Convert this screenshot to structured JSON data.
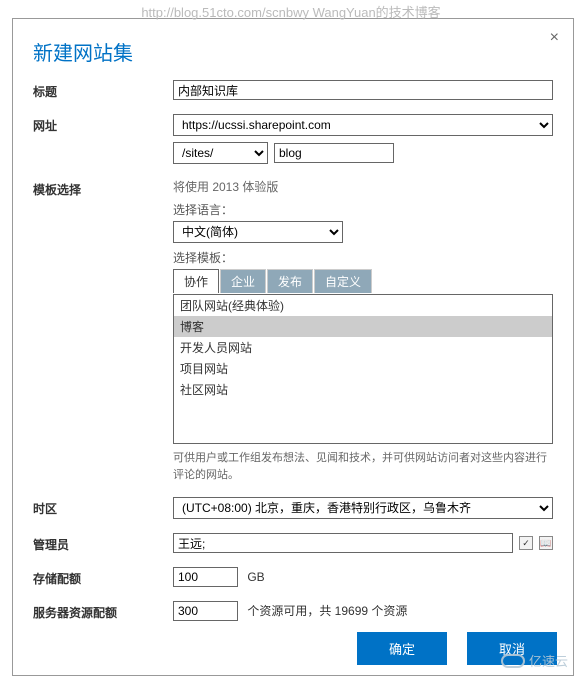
{
  "watermark": "http://blog.51cto.com/scnbwy WangYuan的技术博客",
  "dialog": {
    "title": "新建网站集",
    "close": "×"
  },
  "labels": {
    "title": "标题",
    "url": "网址",
    "template": "模板选择",
    "timezone": "时区",
    "admin": "管理员",
    "storage": "存储配额",
    "server_res": "服务器资源配额"
  },
  "fields": {
    "title_value": "内部知识库",
    "domain_value": "https://ucssi.sharepoint.com",
    "path_value": "/sites/",
    "site_value": "blog",
    "template_hint": "将使用 2013 体验版",
    "lang_label": "选择语言：",
    "lang_value": "中文(简体)",
    "template_label": "选择模板：",
    "tabs": [
      "协作",
      "企业",
      "发布",
      "自定义"
    ],
    "templates": [
      "团队网站(经典体验)",
      "博客",
      "开发人员网站",
      "项目网站",
      "社区网站"
    ],
    "template_selected_index": 1,
    "template_desc": "可供用户或工作组发布想法、见闻和技术，并可供网站访问者对这些内容进行评论的网站。",
    "timezone_value": "(UTC+08:00) 北京，重庆，香港特别行政区，乌鲁木齐",
    "admin_value": "王远;",
    "storage_value": "100",
    "storage_unit": "GB",
    "server_res_value": "300",
    "server_res_hint": "个资源可用，共 19699 个资源"
  },
  "footer": {
    "ok": "确定",
    "cancel": "取消",
    "brand": "亿速云"
  }
}
